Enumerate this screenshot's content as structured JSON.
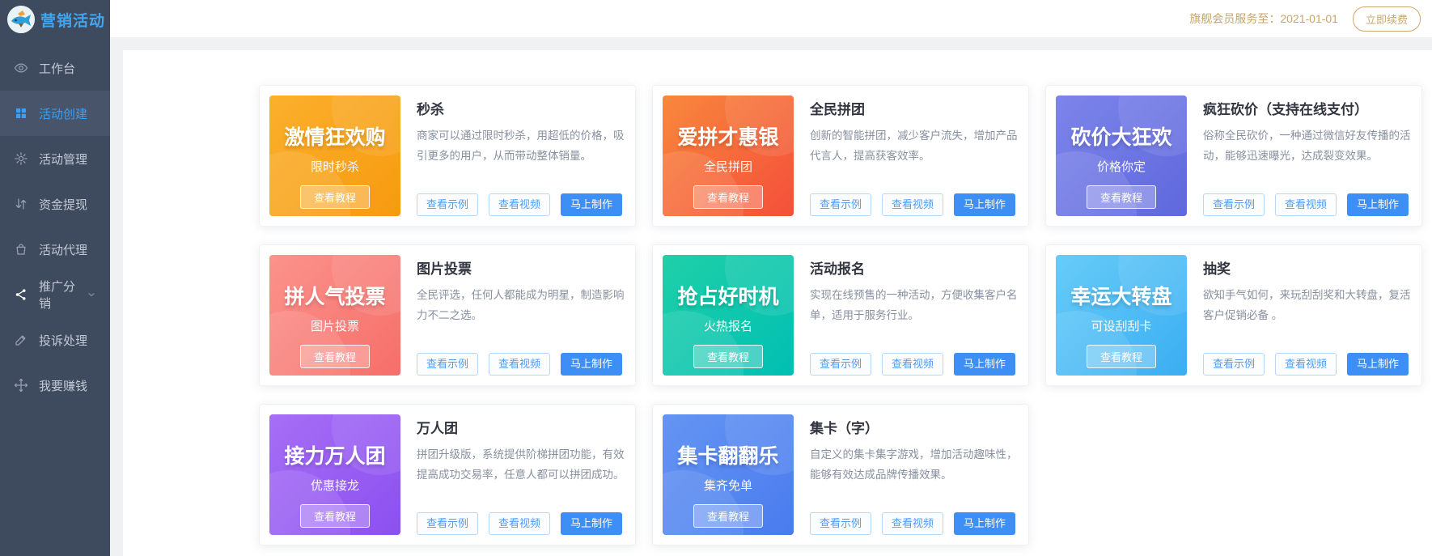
{
  "app": {
    "title": "营销活动"
  },
  "topbar": {
    "membership_text": "旗舰会员服务至：2021-01-01",
    "renew_label": "立即续费"
  },
  "sidebar": {
    "items": [
      {
        "label": "工作台",
        "icon": "eye-icon",
        "active": false
      },
      {
        "label": "活动创建",
        "icon": "grid-icon",
        "active": true
      },
      {
        "label": "活动管理",
        "icon": "gear-icon",
        "active": false
      },
      {
        "label": "资金提现",
        "icon": "transfer-icon",
        "active": false
      },
      {
        "label": "活动代理",
        "icon": "bag-icon",
        "active": false
      },
      {
        "label": "推广分销",
        "icon": "share-icon",
        "active": false,
        "bright": true,
        "chevron": true
      },
      {
        "label": "投诉处理",
        "icon": "pen-icon",
        "active": false
      },
      {
        "label": "我要赚钱",
        "icon": "move-icon",
        "active": false
      }
    ]
  },
  "card_buttons": {
    "tutorial": "查看教程",
    "example": "查看示例",
    "video": "查看视频",
    "create": "马上制作"
  },
  "accent_color": "#3d8ef5",
  "gold_color": "#c8a468",
  "cards": [
    {
      "banner_title": "激情狂欢购",
      "banner_subtitle": "限时秒杀",
      "banner_colors": [
        "#fbb02c",
        "#f79a10"
      ],
      "title": "秒杀",
      "description": "商家可以通过限时秒杀，用超低的价格，吸引更多的用户，从而带动整体销量。"
    },
    {
      "banner_title": "爱拼才惠银",
      "banner_subtitle": "全民拼团",
      "banner_colors": [
        "#f8883c",
        "#f44f3a"
      ],
      "title": "全民拼团",
      "description": "创新的智能拼团，减少客户流失，增加产品代言人，提高获客效率。"
    },
    {
      "banner_title": "砍价大狂欢",
      "banner_subtitle": "价格你定",
      "banner_colors": [
        "#7d85ea",
        "#5f68dd"
      ],
      "title": "疯狂砍价（支持在线支付）",
      "description": "俗称全民砍价，一种通过微信好友传播的活动，能够迅速曝光，达成裂变效果。"
    },
    {
      "banner_title": "拼人气投票",
      "banner_subtitle": "图片投票",
      "banner_colors": [
        "#fb938c",
        "#f76e69"
      ],
      "title": "图片投票",
      "description": "全民评选，任何人都能成为明星，制造影响力不二之选。"
    },
    {
      "banner_title": "抢占好时机",
      "banner_subtitle": "火热报名",
      "banner_colors": [
        "#1fd0a8",
        "#00bfb2"
      ],
      "title": "活动报名",
      "description": "实现在线预售的一种活动，方便收集客户名单，适用于服务行业。"
    },
    {
      "banner_title": "幸运大转盘",
      "banner_subtitle": "可设刮刮卡",
      "banner_colors": [
        "#67ccf8",
        "#3aaef2"
      ],
      "title": "抽奖",
      "description": "欲知手气如何，来玩刮刮奖和大转盘，复活客户促销必备 。"
    },
    {
      "banner_title": "接力万人团",
      "banner_subtitle": "优惠接龙",
      "banner_colors": [
        "#a76ef6",
        "#8b50f0"
      ],
      "title": "万人团",
      "description": "拼团升级版，系统提供阶梯拼团功能，有效提高成功交易率，任意人都可以拼团成功。"
    },
    {
      "banner_title": "集卡翻翻乐",
      "banner_subtitle": "集齐免单",
      "banner_colors": [
        "#6495f3",
        "#4a7bee"
      ],
      "title": "集卡（字）",
      "description": "自定义的集卡集字游戏，增加活动趣味性，能够有效达成品牌传播效果。"
    }
  ]
}
